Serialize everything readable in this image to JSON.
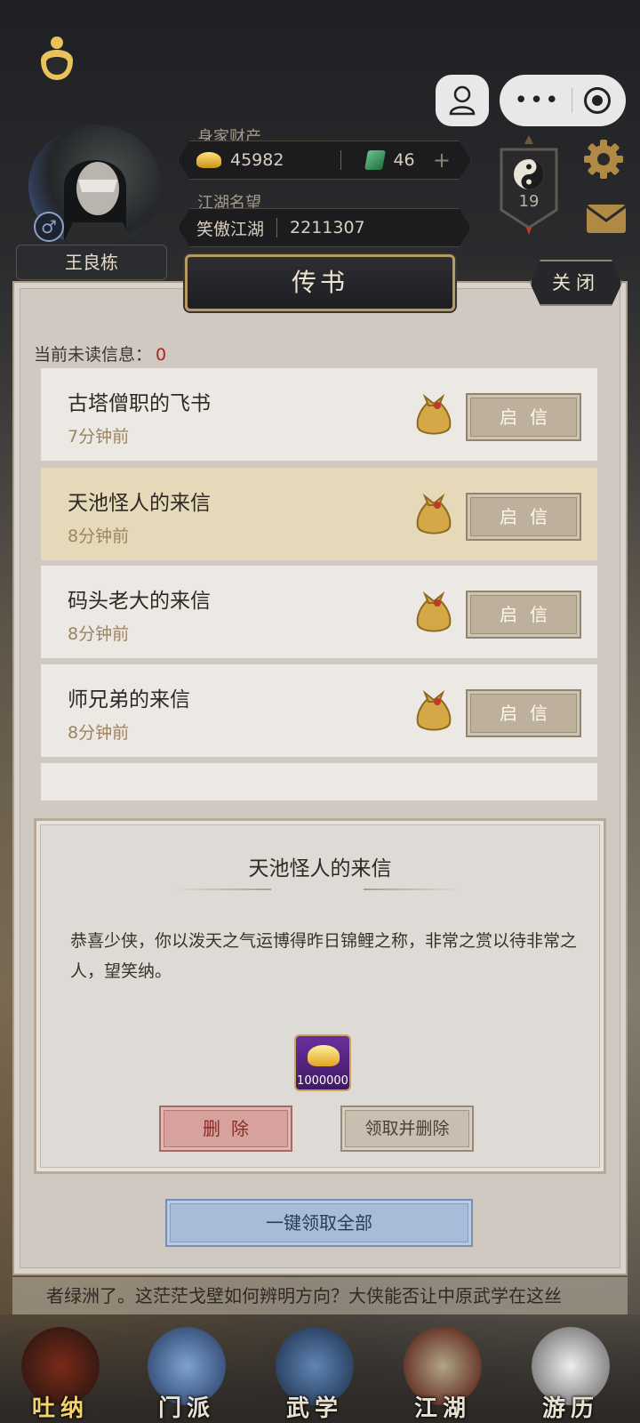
{
  "player": {
    "name": "王良栋",
    "gender_symbol": "♂",
    "wealth_label": "身家财产",
    "gold": "45982",
    "jade": "46",
    "add_symbol": "+",
    "reputation_label": "江湖名望",
    "reputation_title": "笑傲江湖",
    "reputation_value": "2211307",
    "level": "19"
  },
  "panel": {
    "title": "传书",
    "close_label": "关闭",
    "unread_label": "当前未读信息：",
    "unread_count": "0"
  },
  "letters": [
    {
      "title": "古塔僧职的飞书",
      "time": "7分钟前",
      "open_label": "启信",
      "selected": false
    },
    {
      "title": "天池怪人的来信",
      "time": "8分钟前",
      "open_label": "启信",
      "selected": true
    },
    {
      "title": "码头老大的来信",
      "time": "8分钟前",
      "open_label": "启信",
      "selected": false
    },
    {
      "title": "师兄弟的来信",
      "time": "8分钟前",
      "open_label": "启信",
      "selected": false
    }
  ],
  "detail": {
    "title": "天池怪人的来信",
    "body": "恭喜少侠，你以泼天之气运博得昨日锦鲤之称，非常之赏以待非常之人，望笑纳。",
    "reward_qty": "1000000",
    "delete_label": "删除",
    "claim_label": "领取并删除"
  },
  "claim_all_label": "一键领取全部",
  "ticker_text": "者绿洲了。这茫茫戈壁如何辨明方向？大侠能否让中原武学在这丝",
  "nav": [
    {
      "label": "吐纳",
      "active": true
    },
    {
      "label": "门派",
      "active": false
    },
    {
      "label": "武学",
      "active": false
    },
    {
      "label": "江湖",
      "active": false
    },
    {
      "label": "游历",
      "active": false
    }
  ],
  "colors": {
    "unread_count": "#b0231c",
    "selected_row": "#e5d9b9",
    "delete_button": "#d7a19d",
    "claim_all_button": "#a7bcd8",
    "time_text": "#9c8460"
  },
  "icons": {
    "top_left": "topknot-icon",
    "profile": "person-icon",
    "menu": "more-dots-icon",
    "capsule_close": "target-icon",
    "settings": "gear-icon",
    "mail": "mail-icon",
    "level_badge": "taiji-icon",
    "letter_reward": "money-pouch-icon",
    "reward_item": "gold-ingot-icon"
  }
}
